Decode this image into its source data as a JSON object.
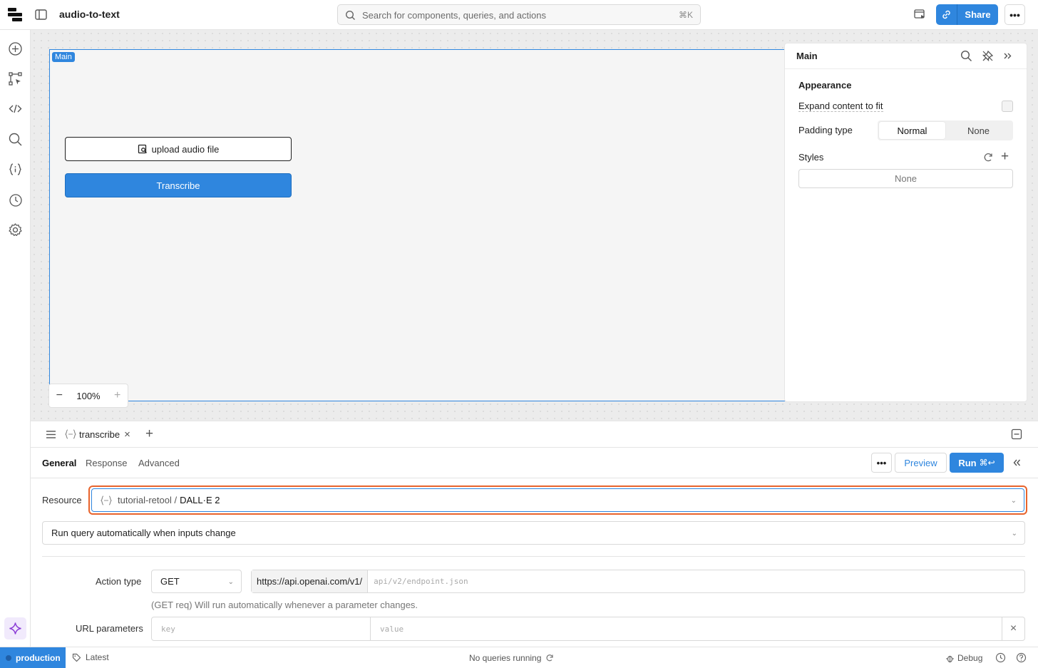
{
  "app": {
    "title": "audio-to-text"
  },
  "search": {
    "placeholder": "Search for components, queries, and actions",
    "shortcut": "⌘K"
  },
  "header": {
    "share_label": "Share",
    "more_label": "•••"
  },
  "colors": {
    "accent": "#2f86de",
    "highlight": "#e8632b"
  },
  "canvas": {
    "frame_tag": "Main",
    "upload_button_label": "upload audio file",
    "transcribe_button_label": "Transcribe",
    "zoom_level": "100%"
  },
  "inspector": {
    "title": "Main",
    "section": "Appearance",
    "expand_label": "Expand content to fit",
    "padding_label": "Padding type",
    "padding_options": [
      "Normal",
      "None"
    ],
    "padding_selected": "Normal",
    "styles_label": "Styles",
    "styles_value": "None"
  },
  "query": {
    "tab_name": "transcribe",
    "subtabs": [
      "General",
      "Response",
      "Advanced"
    ],
    "preview_label": "Preview",
    "run_label": "Run",
    "run_shortcut": "⌘↩",
    "resource_label": "Resource",
    "resource_workspace": "tutorial-retool /",
    "resource_name": "DALL·E 2",
    "trigger_value": "Run query automatically when inputs change",
    "action_type_label": "Action type",
    "method": "GET",
    "url_base": "https://api.openai.com/v1/",
    "url_placeholder": "api/v2/endpoint.json",
    "hint": "(GET req) Will run automatically whenever a parameter changes.",
    "url_params_label": "URL parameters",
    "param_key_placeholder": "key",
    "param_value_placeholder": "value"
  },
  "status": {
    "environment": "production",
    "version": "Latest",
    "queries": "No queries running",
    "debug": "Debug"
  }
}
